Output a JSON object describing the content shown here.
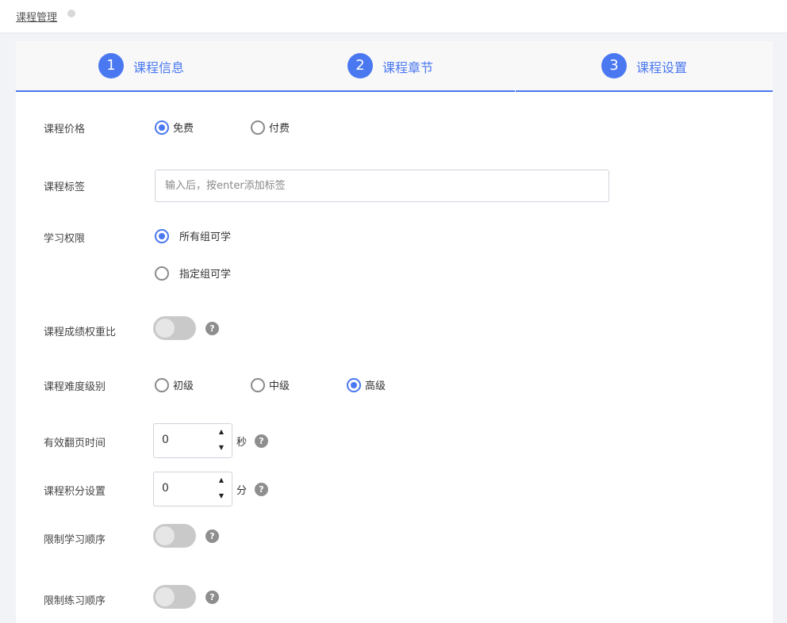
{
  "breadcrumb": {
    "label": "课程管理"
  },
  "steps": [
    {
      "num": "1",
      "label": "课程信息"
    },
    {
      "num": "2",
      "label": "课程章节"
    },
    {
      "num": "3",
      "label": "课程设置"
    }
  ],
  "form": {
    "price": {
      "label": "课程价格",
      "options": [
        {
          "label": "免费",
          "checked": true
        },
        {
          "label": "付费",
          "checked": false
        }
      ]
    },
    "tags": {
      "label": "课程标签",
      "value": "",
      "placeholder": "输入后，按enter添加标签"
    },
    "access": {
      "label": "学习权限",
      "options": [
        {
          "label": "所有组可学",
          "checked": true
        },
        {
          "label": "指定组可学",
          "checked": false
        }
      ]
    },
    "grade_weight": {
      "label": "课程成绩权重比",
      "enabled": false,
      "help": "?"
    },
    "difficulty": {
      "label": "课程难度级别",
      "options": [
        {
          "label": "初级",
          "checked": false
        },
        {
          "label": "中级",
          "checked": false
        },
        {
          "label": "高级",
          "checked": true
        }
      ]
    },
    "page_time": {
      "label": "有效翻页时间",
      "value": "0",
      "unit": "秒",
      "help": "?"
    },
    "points": {
      "label": "课程积分设置",
      "value": "0",
      "unit": "分",
      "help": "?"
    },
    "study_order": {
      "label": "限制学习顺序",
      "enabled": false,
      "help": "?"
    },
    "practice_order": {
      "label": "限制练习顺序",
      "enabled": false,
      "help": "?"
    }
  },
  "icons": {
    "stepper_up": "caret-up-icon",
    "stepper_down": "caret-down-icon",
    "help": "question-circle-icon"
  },
  "colors": {
    "accent": "#4a78f0",
    "toggle_off": "#c9c9c9",
    "background": "#f2f3f7"
  }
}
